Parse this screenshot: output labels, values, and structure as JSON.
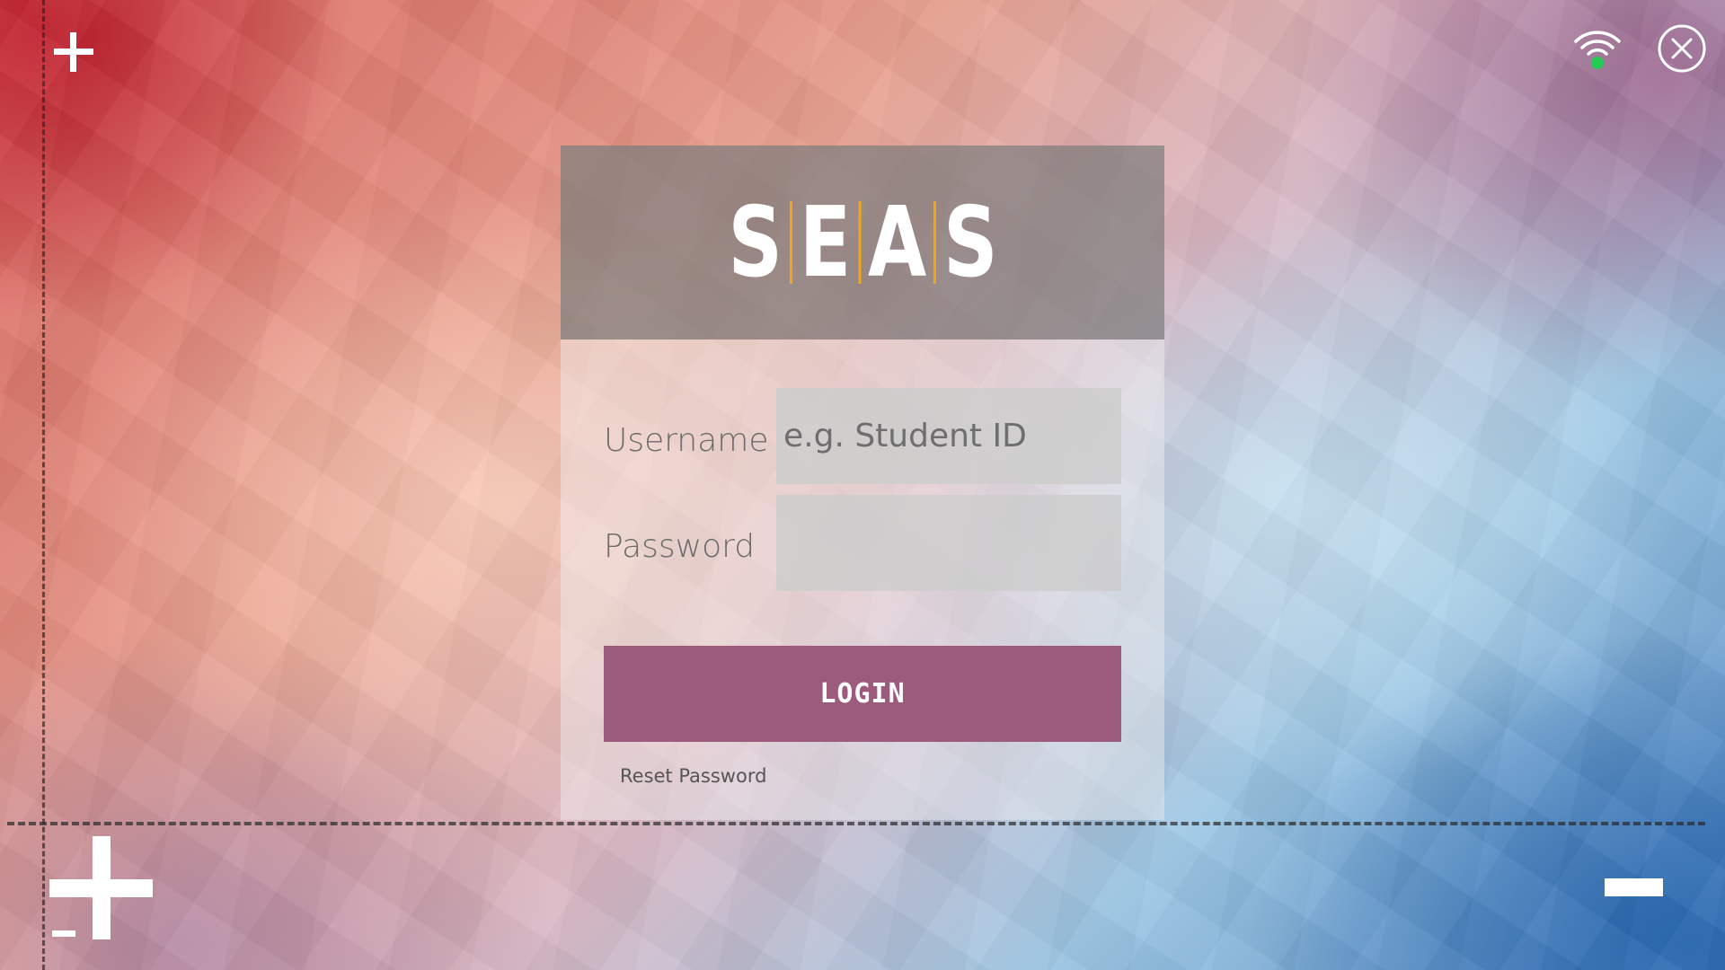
{
  "app": {
    "logo_letters": [
      "S",
      "E",
      "A",
      "S"
    ]
  },
  "form": {
    "username_label": "Username",
    "username_placeholder": "e.g. Student ID",
    "username_value": "",
    "password_label": "Password",
    "password_value": "",
    "login_label": "LOGIN",
    "reset_label": "Reset Password"
  },
  "toolbar": {
    "wifi_icon": "wifi-icon",
    "wifi_status": "connected",
    "close_icon": "close-icon"
  },
  "zoom": {
    "zoom_in_icon": "plus-icon",
    "zoom_out_icon": "minus-icon"
  },
  "colors": {
    "accent": "#9c5a7d",
    "logo_bar": "#f0a419",
    "wifi_status": "#22cc55"
  }
}
